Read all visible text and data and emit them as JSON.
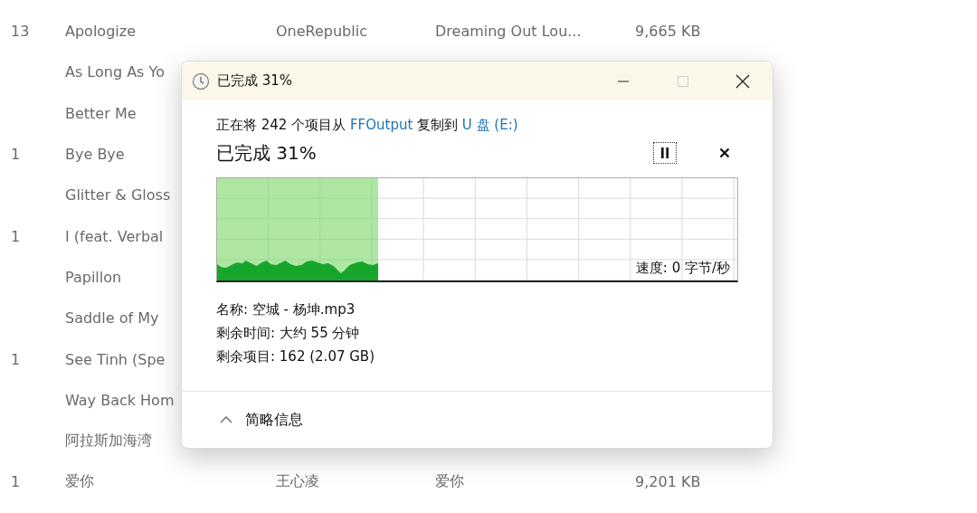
{
  "file_list": {
    "rows": [
      {
        "number": "13",
        "title": "Apologize",
        "artist": "OneRepublic",
        "album": "Dreaming Out Lou...",
        "size": "9,665 KB"
      },
      {
        "title": "As Long As Yo"
      },
      {
        "title": "Better Me"
      },
      {
        "number": "1",
        "title": "Bye Bye"
      },
      {
        "title": "Glitter & Gloss"
      },
      {
        "number": "1",
        "title": "I (feat. Verbal"
      },
      {
        "title": "Papillon"
      },
      {
        "title": "Saddle of My"
      },
      {
        "number": "1",
        "title": "See Tinh (Spe"
      },
      {
        "title": "Way Back Hom"
      },
      {
        "title": "阿拉斯加海湾"
      },
      {
        "number": "1",
        "title": "爱你",
        "artist": "王心凌",
        "album": "爱你",
        "size": "9,201 KB"
      }
    ]
  },
  "dialog": {
    "title": "已完成 31%",
    "summary": {
      "prefix": "正在将 242 个项目从",
      "source": "FFOutput",
      "middle": "复制到",
      "destination": "U 盘 (E:)"
    },
    "heading": "已完成 31%",
    "progress": {
      "level": 0.31,
      "speed": "速度: 0 字节/秒"
    },
    "details": [
      "名称: 空城 - 杨坤.mp3",
      "剩余时间: 大约 55 分钟",
      "剩余项目: 162 (2.07 GB)"
    ],
    "footer": {
      "label": "简略信息",
      "expanded": true
    }
  }
}
